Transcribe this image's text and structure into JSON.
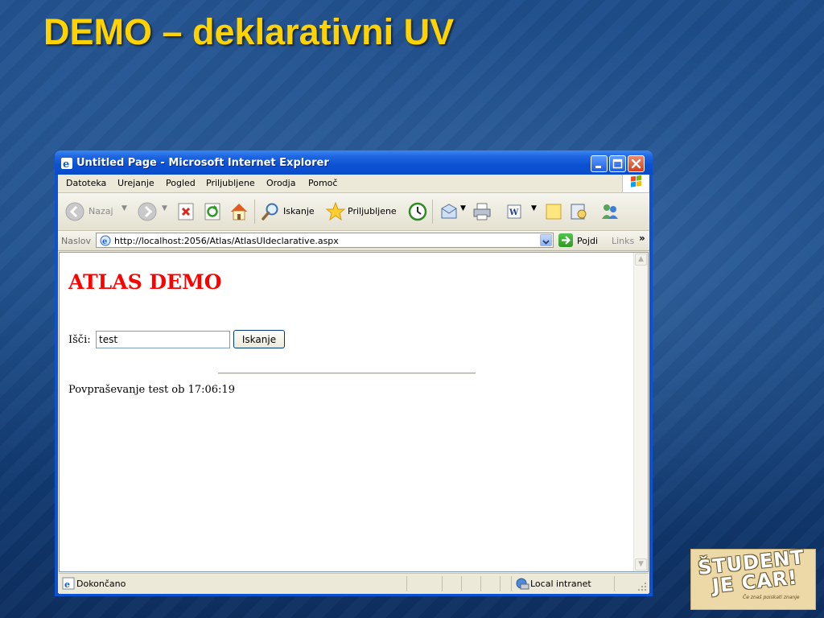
{
  "slide": {
    "title": "DEMO – deklarativni UV"
  },
  "window": {
    "title": "Untitled Page - Microsoft Internet Explorer"
  },
  "menu": {
    "items": [
      "Datoteka",
      "Urejanje",
      "Pogled",
      "Priljubljene",
      "Orodja",
      "Pomoč"
    ]
  },
  "toolbar": {
    "back_label": "Nazaj",
    "search_label": "Iskanje",
    "favorites_label": "Priljubljene"
  },
  "address": {
    "label": "Naslov",
    "url": "http://localhost:2056/Atlas/AtlasUIdeclarative.aspx",
    "go_label": "Pojdi",
    "links_label": "Links",
    "links_chevron": "»"
  },
  "page": {
    "heading": "ATLAS DEMO",
    "search_label": "Išči:",
    "search_value": "test",
    "search_button": "Iskanje",
    "result": "Povpraševanje test ob 17:06:19"
  },
  "status": {
    "text": "Dokončano",
    "zone": "Local intranet"
  },
  "logo": {
    "line1": "ŠTUDENT",
    "line2": "JE CAR!",
    "tagline": "Če znaš poiskati znanje"
  },
  "colors": {
    "title_yellow": "#ffd200",
    "heading_red": "#ff0000",
    "xp_blue": "#0a53d6"
  }
}
